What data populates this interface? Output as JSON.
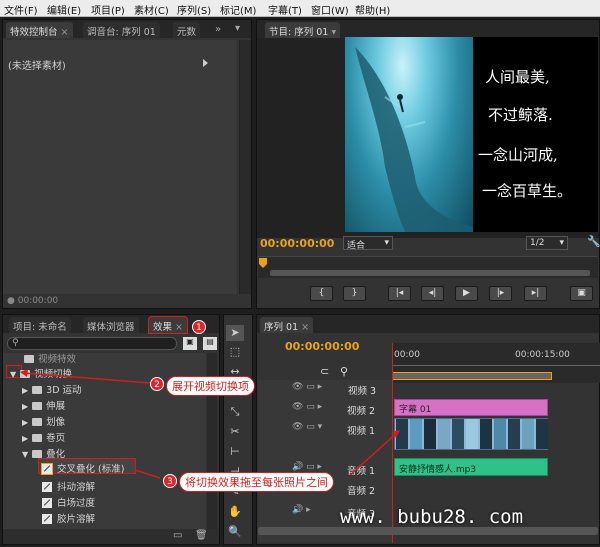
{
  "menu": [
    "文件(F)",
    "编辑(E)",
    "项目(P)",
    "素材(C)",
    "序列(S)",
    "标记(M)",
    "字幕(T)",
    "窗口(W)",
    "帮助(H)"
  ],
  "effect_controls": {
    "tabs": [
      "特效控制台",
      "调音台: 序列 01",
      "元数"
    ],
    "no_clip": "(未选择素材)",
    "timecode": "00:00:00"
  },
  "program_monitor": {
    "tab": "节目: 序列 01",
    "timecode": "00:00:00:00",
    "fit": "适合",
    "resolution": "1/2",
    "poem": [
      "人间最美,",
      "不过鲸落.",
      "一念山河成,",
      "一念百草生。"
    ]
  },
  "project_panel": {
    "tabs": [
      "项目: 未命名",
      "媒体浏览器",
      "效果"
    ],
    "tree": [
      {
        "label": "视频特效",
        "indent": 1,
        "kind": "folder"
      },
      {
        "label": "视频切换",
        "indent": 0,
        "kind": "folder-open"
      },
      {
        "label": "3D 运动",
        "indent": 1,
        "kind": "folder"
      },
      {
        "label": "伸展",
        "indent": 1,
        "kind": "folder"
      },
      {
        "label": "划像",
        "indent": 1,
        "kind": "folder"
      },
      {
        "label": "卷页",
        "indent": 1,
        "kind": "folder"
      },
      {
        "label": "叠化",
        "indent": 1,
        "kind": "folder-open"
      },
      {
        "label": "交叉叠化 (标准)",
        "indent": 2,
        "kind": "effect"
      },
      {
        "label": "抖动溶解",
        "indent": 2,
        "kind": "effect"
      },
      {
        "label": "白场过度",
        "indent": 2,
        "kind": "effect"
      },
      {
        "label": "胶片溶解",
        "indent": 2,
        "kind": "effect"
      }
    ]
  },
  "timeline": {
    "tab": "序列 01",
    "timecode": "00:00:00:00",
    "ruler": [
      "00:00",
      "00:00:15:00"
    ],
    "tracks": [
      "视频 3",
      "视频 2",
      "视频 1",
      "音频 1",
      "音频 2",
      "音频 3"
    ],
    "title_clip": "字幕 01",
    "audio_clip": "安静抒情感人.mp3"
  },
  "annotations": {
    "step1": "1",
    "step2": "2",
    "step2_text": "展开视频切换项",
    "step3": "3",
    "step3_text": "将切换效果拖至每张照片之间"
  },
  "watermark": "www. bubu28. com",
  "colors": {
    "accent": "#e8a317",
    "title_clip": "#d870c8",
    "audio_clip": "#2ec28a",
    "callout": "#d21d1d"
  }
}
